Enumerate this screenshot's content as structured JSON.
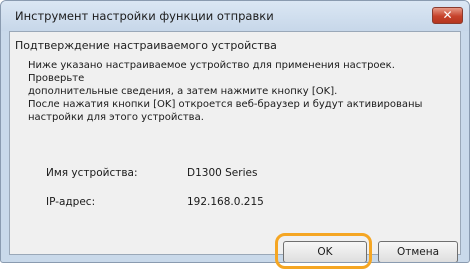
{
  "window": {
    "title": "Инструмент настройки функции отправки",
    "close_glyph": "✕"
  },
  "content": {
    "heading": "Подтверждение настраиваемого устройства",
    "message_lines": [
      "Ниже указано настраиваемое устройство для применения настроек. Проверьте",
      "дополнительные сведения, а затем нажмите кнопку [OK].",
      "После нажатия кнопки [OK] откроется веб-браузер и будут активированы",
      "настройки для этого устройства."
    ],
    "device_name_label": "Имя устройства:",
    "device_name_value": "D1300 Series",
    "ip_label": "IP-адрес:",
    "ip_value": "192.168.0.215"
  },
  "buttons": {
    "ok": "OK",
    "cancel": "Отмена"
  },
  "colors": {
    "highlight": "#f5a623",
    "close_button": "#c6422b",
    "title_bar": "#c9d9ea"
  }
}
